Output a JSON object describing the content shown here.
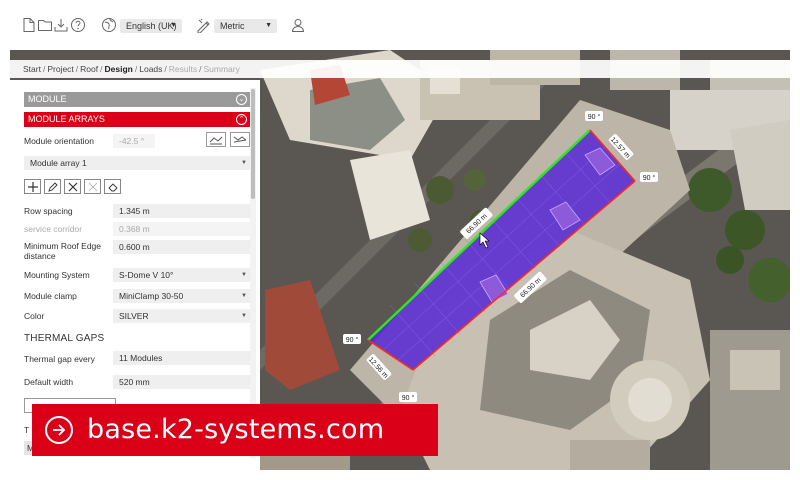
{
  "toolbar": {
    "language": "English (UK)",
    "units": "Metric"
  },
  "breadcrumb": [
    {
      "label": "Start",
      "state": "done"
    },
    {
      "label": "Project",
      "state": "done"
    },
    {
      "label": "Roof",
      "state": "done"
    },
    {
      "label": "Design",
      "state": "current"
    },
    {
      "label": "Loads",
      "state": "done"
    },
    {
      "label": "Results",
      "state": "disabled"
    },
    {
      "label": "Summary",
      "state": "disabled"
    }
  ],
  "panel": {
    "module_header": "MODULE",
    "module_arrays_header": "MODULE ARRAYS",
    "module_orientation_label": "Module orientation",
    "module_orientation_value": "-42.5 °",
    "array_select": "Module array 1",
    "row_spacing_label": "Row spacing",
    "row_spacing_value": "1.345 m",
    "service_corridor_label": "service corridor",
    "service_corridor_value": "0.368 m",
    "min_edge_label_1": "Minimum Roof Edge",
    "min_edge_label_2": "distance",
    "min_edge_value": "0.600 m",
    "mounting_label": "Mounting System",
    "mounting_value": "S-Dome V 10°",
    "clamp_label": "Module clamp",
    "clamp_value": "MiniClamp 30-50",
    "color_label": "Color",
    "color_value": "SILVER",
    "thermal_heading": "THERMAL GAPS",
    "thermal_every_label": "Thermal gap every",
    "thermal_every_value": "11 Modules",
    "default_width_label": "Default width",
    "default_width_value": "520 mm",
    "partial_labels": [
      "T",
      "M"
    ]
  },
  "map": {
    "dimensions": {
      "length_top": "66.90 m",
      "length_bottom": "66.90 m",
      "width_right": "12.57 m",
      "width_left": "12.56 m"
    },
    "angles": [
      "90 °",
      "90 °",
      "90 °",
      "90 °"
    ]
  },
  "banner": {
    "url": "base.k2-systems.com"
  },
  "colors": {
    "accent_red": "#d90017",
    "panel_header_grey": "#9a9a9a",
    "array_purple": "#5b2fd1",
    "edge_green": "#2ee81f",
    "edge_red": "#ff2a1a"
  }
}
